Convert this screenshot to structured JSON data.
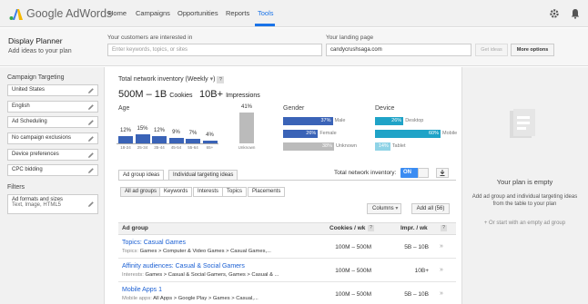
{
  "topbar": {
    "logo_text": "Google AdWords",
    "nav": [
      "Home",
      "Campaigns",
      "Opportunities",
      "Reports",
      "Tools"
    ],
    "active_nav": "Tools",
    "accent_color": "#1a73e8",
    "icons": [
      "gear-icon",
      "bell-icon"
    ]
  },
  "header": {
    "title": "Display Planner",
    "subtitle": "Add ideas to your plan",
    "interest_label": "Your customers are interested in",
    "interest_placeholder": "Enter keywords, topics, or sites",
    "landing_label": "Your landing page",
    "landing_value": "candycrushsaga.com",
    "get_ideas": "Get ideas",
    "more_options": "More options"
  },
  "sidebar": {
    "campaign_targeting_label": "Campaign Targeting",
    "items": [
      "United States",
      "English",
      "Ad Scheduling",
      "No campaign exclusions",
      "Device preferences",
      "CPC bidding"
    ],
    "filters_label": "Filters",
    "filter_item_line1": "Ad formats and sizes",
    "filter_item_line2": "Text, Image, HTML5"
  },
  "inventory": {
    "title": "Total network inventory (Weekly",
    "dropdown_arrow": "▾",
    "help": "?",
    "cookies_value": "500M – 1B",
    "cookies_label": "Cookies",
    "impressions_value": "10B+",
    "impressions_label": "Impressions",
    "age_label": "Age",
    "gender_label": "Gender",
    "device_label": "Device"
  },
  "age": {
    "groups": [
      {
        "label": "18-24",
        "pct": "12%",
        "value": 12
      },
      {
        "label": "25-34",
        "pct": "15%",
        "value": 15
      },
      {
        "label": "35-44",
        "pct": "12%",
        "value": 12
      },
      {
        "label": "45-54",
        "pct": "9%",
        "value": 9
      },
      {
        "label": "55-64",
        "pct": "7%",
        "value": 7
      },
      {
        "label": "65+",
        "pct": "4%",
        "value": 4
      }
    ],
    "unknown": {
      "label": "Unknown",
      "pct": "41%",
      "value": 41
    }
  },
  "gender": [
    {
      "label": "Male",
      "pct": "37%",
      "value": 37,
      "color": "#3a63b7"
    },
    {
      "label": "Female",
      "pct": "26%",
      "value": 26,
      "color": "#3a63b7"
    },
    {
      "label": "Unknown",
      "pct": "38%",
      "value": 38,
      "color": "#bbbbbb"
    }
  ],
  "device": [
    {
      "label": "Desktop",
      "pct": "26%",
      "value": 26,
      "color": "#1fa3c7"
    },
    {
      "label": "Mobile",
      "pct": "60%",
      "value": 60,
      "color": "#1fa3c7"
    },
    {
      "label": "Tablet",
      "pct": "14%",
      "value": 14,
      "color": "#8fd3e6"
    }
  ],
  "tabs": {
    "main": [
      "Ad group ideas",
      "Individual targeting ideas"
    ],
    "toggle_label": "Total network inventory:",
    "toggle_state": "ON",
    "sub": [
      "All ad groups",
      "Keywords",
      "Interests",
      "Topics",
      "Placements"
    ]
  },
  "table_controls": {
    "columns": "Columns",
    "add_all": "Add all (56)"
  },
  "table": {
    "headers": [
      "Ad group",
      "Cookies / wk",
      "Impr. / wk"
    ],
    "help": "?",
    "rows": [
      {
        "title": "Topics: Casual Games",
        "kind": "Topics:",
        "path": "Games > Computer & Video Games > Casual Games,...",
        "cookies": "100M – 500M",
        "impr": "5B – 10B"
      },
      {
        "title": "Affinity audiences: Casual & Social Gamers",
        "kind": "Interests:",
        "path": "Games > Casual & Social Gamers, Games > Casual & ...",
        "cookies": "100M – 500M",
        "impr": "10B+"
      },
      {
        "title": "Mobile Apps 1",
        "kind": "Mobile apps:",
        "path": "All Apps > Google Play > Games > Casual,...",
        "cookies": "100M – 500M",
        "impr": "5B – 10B"
      }
    ]
  },
  "plan": {
    "empty_title": "Your plan is empty",
    "help_text": "Add ad group and individual targeting ideas from the table to your plan",
    "or_text": "+ Or start with an empty ad group"
  }
}
